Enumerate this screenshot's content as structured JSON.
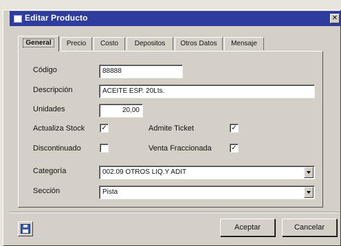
{
  "window": {
    "title": "Editar Producto",
    "close_glyph": "✕"
  },
  "tabs": [
    "General",
    "Precio",
    "Costo",
    "Depositos",
    "Otros Datos",
    "Mensaje"
  ],
  "form": {
    "codigo_label": "Código",
    "codigo_value": "88888",
    "descripcion_label": "Descripción",
    "descripcion_value": "ACEITE  ESP. 20Lts.",
    "unidades_label": "Unidades",
    "unidades_value": "20,00",
    "actualiza_stock_label": "Actualiza Stock",
    "actualiza_stock_checked": true,
    "admite_ticket_label": "Admite Ticket",
    "admite_ticket_checked": true,
    "discontinuado_label": "Discontinuado",
    "discontinuado_checked": false,
    "venta_fraccionada_label": "Venta Fraccionada",
    "venta_fraccionada_checked": true,
    "categoria_label": "Categoría",
    "categoria_value": "002.09 OTROS LIQ.Y ADIT",
    "seccion_label": "Sección",
    "seccion_value": "Pista"
  },
  "buttons": {
    "aceptar": "Aceptar",
    "cancelar": "Cancelar"
  },
  "icons": {
    "save": "floppy-disk-icon",
    "dropdown": "chevron-down-icon",
    "title": "window-app-icon"
  },
  "colors": {
    "titlebar": "#2e3c9e",
    "dialog_bg": "#d4d0c8"
  }
}
